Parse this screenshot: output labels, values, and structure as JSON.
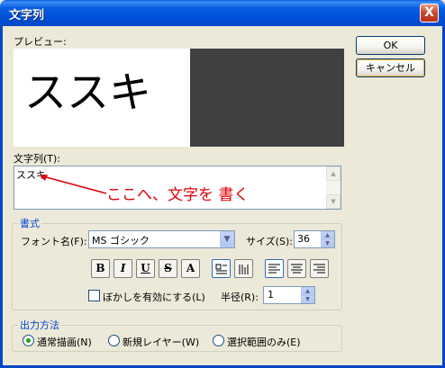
{
  "window": {
    "title": "文字列",
    "close_label": "X"
  },
  "preview": {
    "label": "プレビュー:",
    "text": "ススキ"
  },
  "buttons": {
    "ok": "OK",
    "cancel": "キャンセル"
  },
  "text_field": {
    "label": "文字列(T):",
    "value": "ススキ",
    "annotation": "ここへ、文字を 書く",
    "annotation_color": "#e0000a"
  },
  "format": {
    "group_label": "書式",
    "font_label": "フォント名(F):",
    "font_value": "MS ゴシック",
    "size_label": "サイズ(S):",
    "size_value": "36",
    "style_buttons": [
      "B",
      "I",
      "U",
      "S",
      "A"
    ],
    "blur_label": "ぼかしを有効にする(L)",
    "blur_checked": false,
    "radius_label": "半径(R):",
    "radius_value": "1"
  },
  "output": {
    "group_label": "出力方法",
    "options": [
      "通常描画(N)",
      "新規レイヤー(W)",
      "選択範囲のみ(E)"
    ],
    "selected_index": 0
  },
  "colors": {
    "title_bar": "#0a5ee0",
    "group_label": "#0046d5"
  }
}
